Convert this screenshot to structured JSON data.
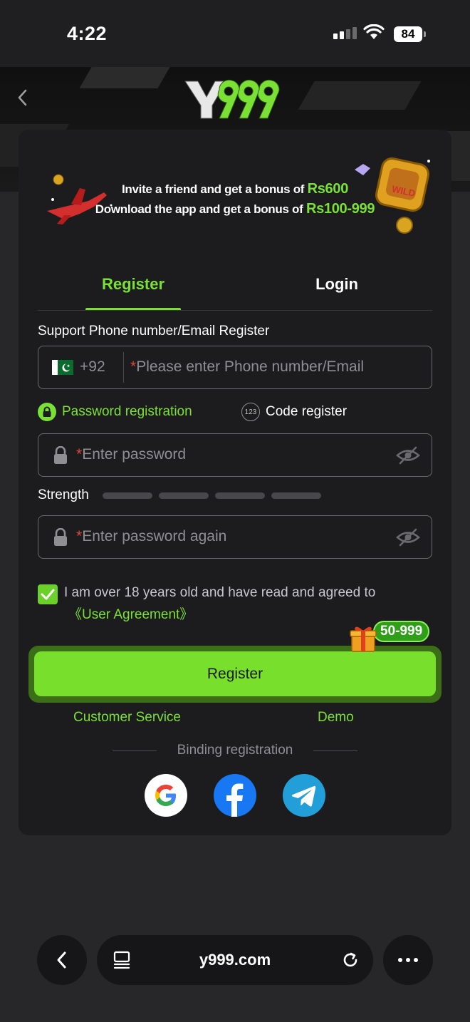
{
  "status_bar": {
    "time": "4:22",
    "battery": "84"
  },
  "header": {
    "logo_text": "Y999"
  },
  "banner": {
    "line1_text": "Invite a friend and get a bonus of",
    "line1_amount": "Rs600",
    "line2_text": "Download the app and get a bonus of",
    "line2_amount": "Rs100-999"
  },
  "tabs": [
    {
      "label": "Register",
      "active": true
    },
    {
      "label": "Login",
      "active": false
    }
  ],
  "form": {
    "section_label": "Support Phone number/Email Register",
    "country_code": "+92",
    "phone_placeholder": "Please enter Phone number/Email",
    "required_mark": "*",
    "password_mode_label": "Password registration",
    "code_mode_label": "Code register",
    "code_icon_text": "123",
    "password_placeholder": "Enter password",
    "strength_label": "Strength",
    "password_again_placeholder": "Enter password again",
    "agreement_text": "I am over 18 years old and have read and agreed to",
    "agreement_link": "《User Agreement》",
    "agreement_checked": true,
    "bonus_badge": "50-999",
    "register_button": "Register",
    "customer_service": "Customer Service",
    "demo": "Demo",
    "binding_label": "Binding registration"
  },
  "social": [
    "google-icon",
    "facebook-icon",
    "telegram-icon"
  ],
  "browser": {
    "url": "y999.com"
  },
  "colors": {
    "accent": "#7be036",
    "card": "#1c1c1e",
    "background": "#27272a"
  }
}
